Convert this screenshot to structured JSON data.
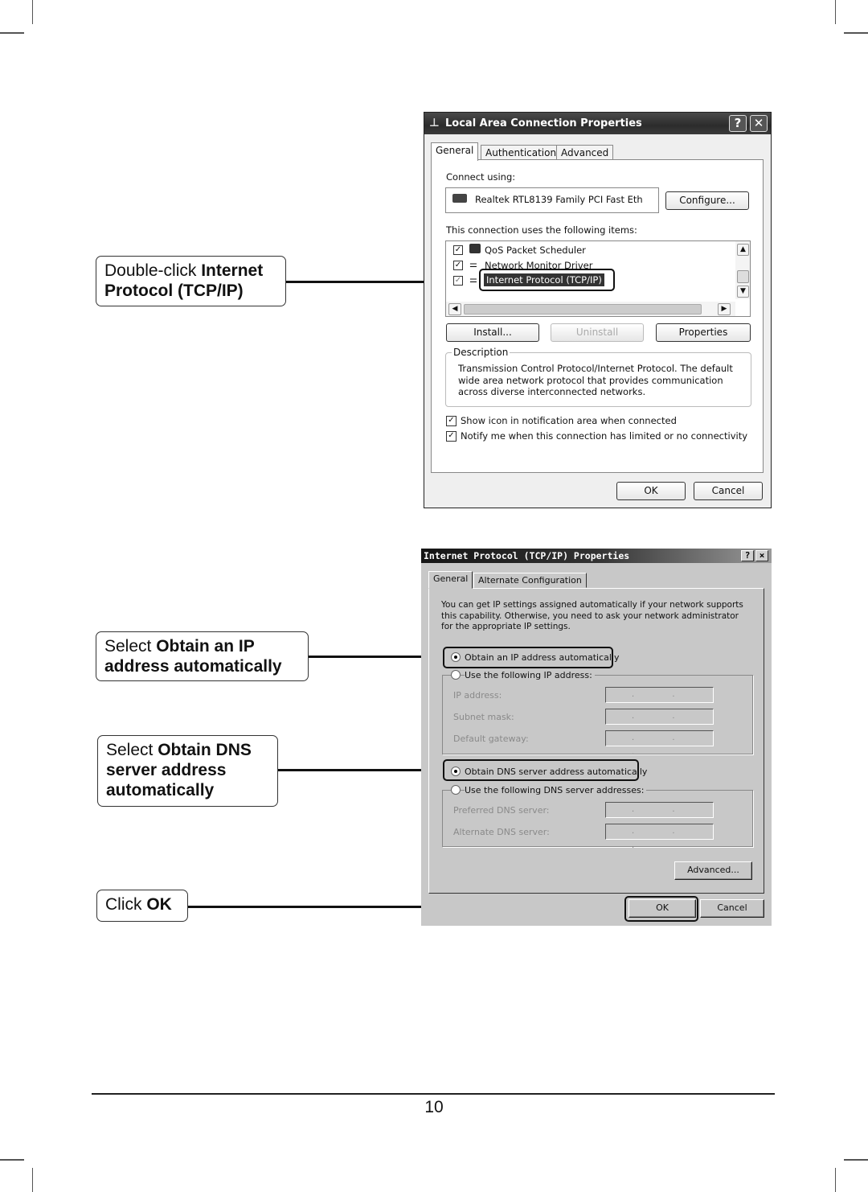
{
  "page": {
    "page_number": "10"
  },
  "callouts": {
    "step1": {
      "prefix": "Double-click ",
      "bold": "Internet Protocol (TCP/IP)"
    },
    "step2": {
      "prefix": "Select ",
      "bold": "Obtain an IP address automatically"
    },
    "step3": {
      "prefix": "Select ",
      "bold": "Obtain DNS server address automatically"
    },
    "step4": {
      "prefix": "Click ",
      "bold": "OK"
    }
  },
  "dialog1": {
    "title": "Local Area Connection Properties",
    "title_icon": "network-connection-icon",
    "help_button": "?",
    "close_button": "✕",
    "tabs": [
      "General",
      "Authentication",
      "Advanced"
    ],
    "active_tab": "General",
    "connect_using_label": "Connect using:",
    "adapter_name": "Realtek RTL8139 Family PCI Fast Eth",
    "configure_button": "Configure...",
    "items_label": "This connection uses the following items:",
    "items": [
      {
        "label": "QoS Packet Scheduler",
        "checked": true,
        "icon": "computer-icon"
      },
      {
        "label": "Network Monitor Driver",
        "checked": true,
        "icon": "network-protocol-icon"
      },
      {
        "label": "Internet Protocol (TCP/IP)",
        "checked": true,
        "icon": "network-protocol-icon",
        "selected": true
      }
    ],
    "install_button": "Install...",
    "uninstall_button": "Uninstall",
    "properties_button": "Properties",
    "description_legend": "Description",
    "description_text": "Transmission Control Protocol/Internet Protocol. The default wide area network protocol that provides communication across diverse interconnected networks.",
    "show_icon_label": "Show icon in notification area when connected",
    "show_icon_checked": true,
    "notify_label": "Notify me when this connection has limited or no connectivity",
    "notify_checked": true,
    "ok_button": "OK",
    "cancel_button": "Cancel"
  },
  "dialog2": {
    "title": "Internet Protocol (TCP/IP) Properties",
    "help_button": "?",
    "close_button": "×",
    "tabs": [
      "General",
      "Alternate Configuration"
    ],
    "active_tab": "General",
    "intro_text": "You can get IP settings assigned automatically if your network supports this capability. Otherwise, you need to ask your network administrator for the appropriate IP settings.",
    "obtain_ip_auto": "Obtain an IP address automatically",
    "use_following_ip": "Use the following IP address:",
    "ip_mode": "automatic",
    "ip_fields": [
      {
        "label": "IP address:",
        "value": ". . ."
      },
      {
        "label": "Subnet mask:",
        "value": ". . ."
      },
      {
        "label": "Default gateway:",
        "value": ". . ."
      }
    ],
    "obtain_dns_auto": "Obtain DNS server address automatically",
    "use_following_dns": "Use the following DNS server addresses:",
    "dns_mode": "automatic",
    "dns_fields": [
      {
        "label": "Preferred DNS server:",
        "value": ". . ."
      },
      {
        "label": "Alternate DNS server:",
        "value": ". . ."
      }
    ],
    "advanced_button": "Advanced...",
    "ok_button": "OK",
    "cancel_button": "Cancel"
  }
}
